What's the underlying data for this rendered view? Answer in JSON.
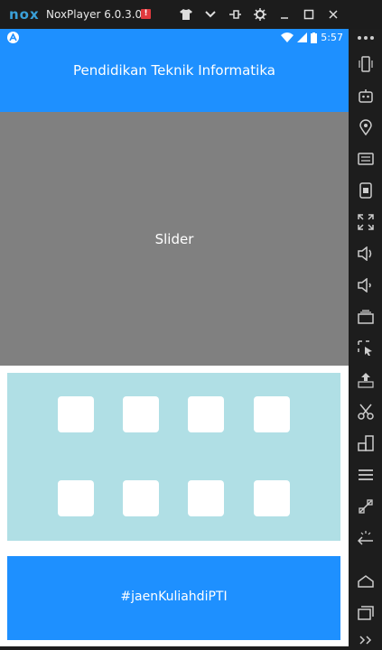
{
  "window": {
    "logo_text": "nox",
    "title": "NoxPlayer 6.0.3.0",
    "alert_badge": "!",
    "controls": [
      "shirt-icon",
      "chevron-down-icon",
      "pin-icon",
      "gear-icon",
      "minimize-icon",
      "maximize-icon",
      "close-icon"
    ]
  },
  "status_bar": {
    "time": "5:57"
  },
  "app": {
    "title": "Pendidikan Teknik Informatika",
    "slider_label": "Slider",
    "footer_label": "#jaenKuliahdiPTI",
    "colors": {
      "primary": "#1e90ff",
      "slider": "#808080",
      "panel": "#b0dfe5"
    }
  },
  "side_toolbar": [
    "more-icon",
    "phone-rotate-icon",
    "robot-icon",
    "location-icon",
    "keyboard-icon",
    "screen-record-icon",
    "fullscreen-icon",
    "volume-up-icon",
    "volume-down-icon",
    "multi-instance-icon",
    "screenshot-icon",
    "apk-install-icon",
    "cut-icon",
    "multi-drive-icon",
    "menu-icon",
    "shake-icon",
    "back-icon",
    "home-icon",
    "recent-apps-icon",
    "expand-icon"
  ]
}
